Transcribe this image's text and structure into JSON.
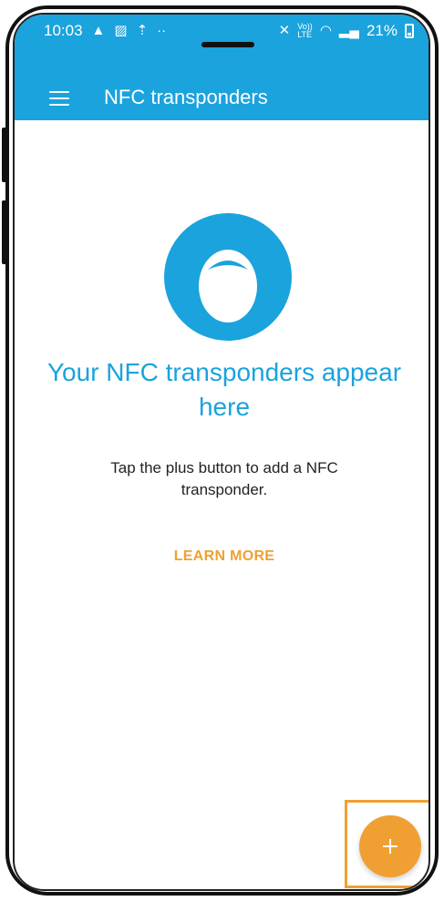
{
  "statusbar": {
    "time": "10:03",
    "left_icons": [
      "alert-icon",
      "image-icon",
      "upload-icon",
      "more-dots-icon"
    ],
    "volte": "Vo))\nLTE",
    "battery": "21%"
  },
  "appbar": {
    "title": "NFC transponders",
    "menu_icon": "hamburger-menu-icon"
  },
  "empty_state": {
    "icon": "nfc-tag-icon",
    "headline": "Your NFC transponders appear here",
    "subtext": "Tap the plus button to add a NFC transponder.",
    "learn_more": "LEARN MORE"
  },
  "fab": {
    "icon": "plus-icon",
    "label": "+"
  },
  "colors": {
    "primary": "#1aa3dd",
    "accent": "#f0a032",
    "text": "#222222",
    "background": "#ffffff"
  }
}
